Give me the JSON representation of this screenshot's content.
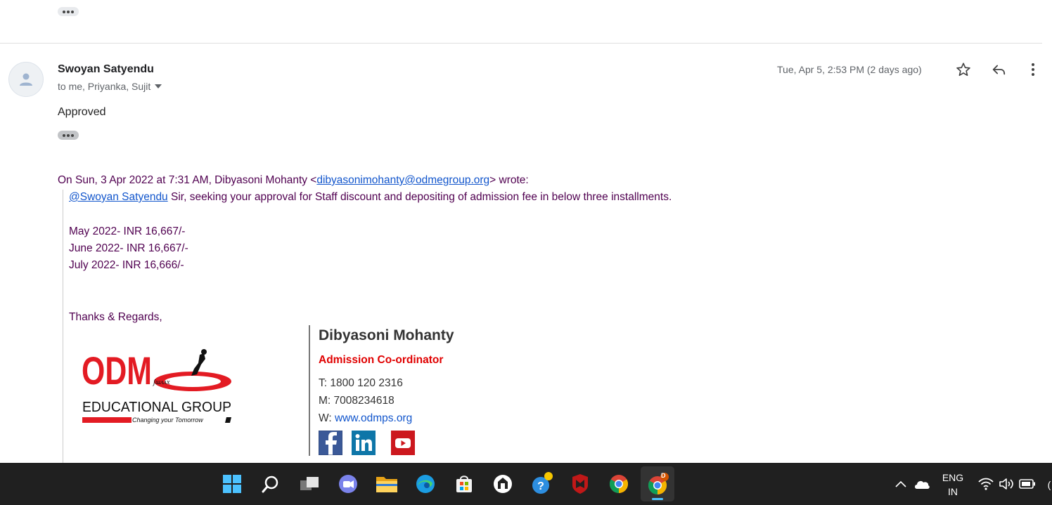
{
  "email": {
    "sender_name": "Swoyan Satyendu",
    "recipients": "to me, Priyanka, Sujit",
    "date": "Tue, Apr 5, 2:53 PM (2 days ago)",
    "body": "Approved",
    "quote_header_prefix": "On Sun, 3 Apr 2022 at 7:31 AM, Dibyasoni Mohanty <",
    "quote_header_email": "dibyasonimohanty@odmegroup.org",
    "quote_header_suffix": "> wrote:",
    "quote_mention": "@Swoyan Satyendu",
    "quote_line1_rest": " Sir, seeking your approval for Staff discount and depositing of admission fee in below three installments.",
    "installments": [
      "May 2022- INR 16,667/-",
      "June 2022- INR 16,667/-",
      "July 2022- INR 16,666/-"
    ],
    "closing": "Thanks & Regards,"
  },
  "signature": {
    "logo_text": "ODM",
    "logo_subtitle": "EDUCATIONAL GROUP",
    "logo_tagline": "Changing your Tomorrow",
    "name": "Dibyasoni Mohanty",
    "title": "Admission Co-ordinator",
    "phone_label": "T: ",
    "phone": "1800 120 2316",
    "mobile_label": "M: ",
    "mobile": "7008234618",
    "web_label": "W: ",
    "web": "www.odmps.org",
    "social": [
      "facebook-icon",
      "linkedin-icon",
      "youtube-icon"
    ]
  },
  "taskbar": {
    "apps": [
      "windows-start-icon",
      "search-icon",
      "task-view-icon",
      "teams-chat-icon",
      "file-explorer-icon",
      "edge-icon",
      "store-icon",
      "app-icon",
      "help-icon",
      "mcafee-icon",
      "chrome-icon",
      "chrome-profile-icon"
    ],
    "badge_letter": "D",
    "lang_top": "ENG",
    "lang_bottom": "IN",
    "clock_partial": "("
  },
  "colors": {
    "quote_text": "#500050",
    "link": "#1155cc",
    "sig_title": "#e00000",
    "taskbar_bg": "#202020"
  }
}
